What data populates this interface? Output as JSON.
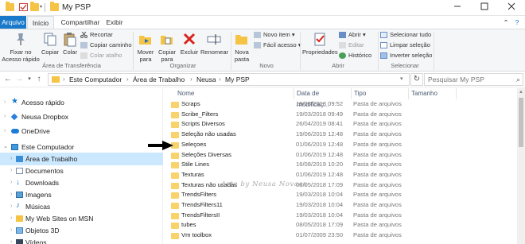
{
  "window": {
    "title": "My PSP",
    "controls": [
      "minimize-icon",
      "maximize-icon",
      "close-icon"
    ]
  },
  "ribbon_tabs": [
    "Arquivo",
    "Início",
    "Compartilhar",
    "Exibir"
  ],
  "ribbon": {
    "clipboard": {
      "pin_label": "Fixar no Acesso rápido",
      "copy_label": "Copiar",
      "paste_label": "Colar",
      "cut_label": "Recortar",
      "copy_path_label": "Copiar caminho",
      "paste_shortcut_label": "Colar atalho",
      "group_label": "Área de Transferência"
    },
    "organize": {
      "move_label": "Mover para",
      "copy_to_label": "Copiar para",
      "delete_label": "Excluir",
      "rename_label": "Renomear",
      "group_label": "Organizar"
    },
    "new": {
      "new_folder_label": "Nova pasta",
      "new_item_label": "Novo item",
      "easy_access_label": "Fácil acesso",
      "group_label": "Novo"
    },
    "open": {
      "properties_label": "Propriedades",
      "open_label": "Abrir",
      "edit_label": "Editar",
      "history_label": "Histórico",
      "group_label": "Abrir"
    },
    "select": {
      "select_all_label": "Selecionar tudo",
      "clear_selection_label": "Limpar seleção",
      "invert_selection_label": "Inverter seleção",
      "group_label": "Selecionar"
    }
  },
  "address": {
    "breadcrumbs": [
      "Este Computador",
      "Área de Trabalho",
      "Neusa",
      "My PSP"
    ],
    "search_placeholder": "Pesquisar My PSP"
  },
  "nav_pane": [
    {
      "label": "Acesso rápido",
      "icon": "star-icon"
    },
    {
      "label": "Neusa Dropbox",
      "icon": "dropbox-icon"
    },
    {
      "label": "OneDrive",
      "icon": "cloud-icon"
    },
    {
      "label": "Este Computador",
      "icon": "computer-icon"
    },
    {
      "label": "Área de Trabalho",
      "icon": "desktop-icon"
    },
    {
      "label": "Documentos",
      "icon": "documents-icon"
    },
    {
      "label": "Downloads",
      "icon": "download-icon"
    },
    {
      "label": "Imagens",
      "icon": "pictures-icon"
    },
    {
      "label": "Músicas",
      "icon": "music-icon"
    },
    {
      "label": "My Web Sites on MSN",
      "icon": "web-sites-icon"
    },
    {
      "label": "Objetos 3D",
      "icon": "3d-objects-icon"
    },
    {
      "label": "Vídeos",
      "icon": "videos-icon"
    }
  ],
  "columns": [
    "Nome",
    "Data de modificaç...",
    "Tipo",
    "Tamanho"
  ],
  "files": [
    {
      "name": "Scraps",
      "date": "19/03/2018 09:52",
      "type": "Pasta de arquivos"
    },
    {
      "name": "Scribe_Filters",
      "date": "19/03/2018 09:49",
      "type": "Pasta de arquivos"
    },
    {
      "name": "Scripts Diversos",
      "date": "26/04/2019 08:41",
      "type": "Pasta de arquivos"
    },
    {
      "name": "Seleção não usadas",
      "date": "19/06/2019 12:48",
      "type": "Pasta de arquivos"
    },
    {
      "name": "Seleçoes",
      "date": "01/06/2019 12:48",
      "type": "Pasta de arquivos"
    },
    {
      "name": "Seleções Diversas",
      "date": "01/06/2019 12:48",
      "type": "Pasta de arquivos"
    },
    {
      "name": "Stile Lines",
      "date": "16/08/2019 10:20",
      "type": "Pasta de arquivos"
    },
    {
      "name": "Texturas",
      "date": "01/06/2019 12:48",
      "type": "Pasta de arquivos"
    },
    {
      "name": "Texturas não usadas",
      "date": "08/05/2018 17:09",
      "type": "Pasta de arquivos"
    },
    {
      "name": "TrendsFilters",
      "date": "19/03/2018 10:04",
      "type": "Pasta de arquivos"
    },
    {
      "name": "TrendsFilters11",
      "date": "19/03/2018 10:04",
      "type": "Pasta de arquivos"
    },
    {
      "name": "TrendsFiltersII",
      "date": "19/03/2018 10:04",
      "type": "Pasta de arquivos"
    },
    {
      "name": "tubes",
      "date": "08/05/2018 17:09",
      "type": "Pasta de arquivos"
    },
    {
      "name": "Vm toolbox",
      "date": "01/07/2009 23:50",
      "type": "Pasta de arquivos"
    }
  ],
  "watermark": "Arte by Neusa Novaes",
  "colors": {
    "accent": "#1979ca",
    "folder": "#f8d36b",
    "selection": "#cce8ff"
  }
}
